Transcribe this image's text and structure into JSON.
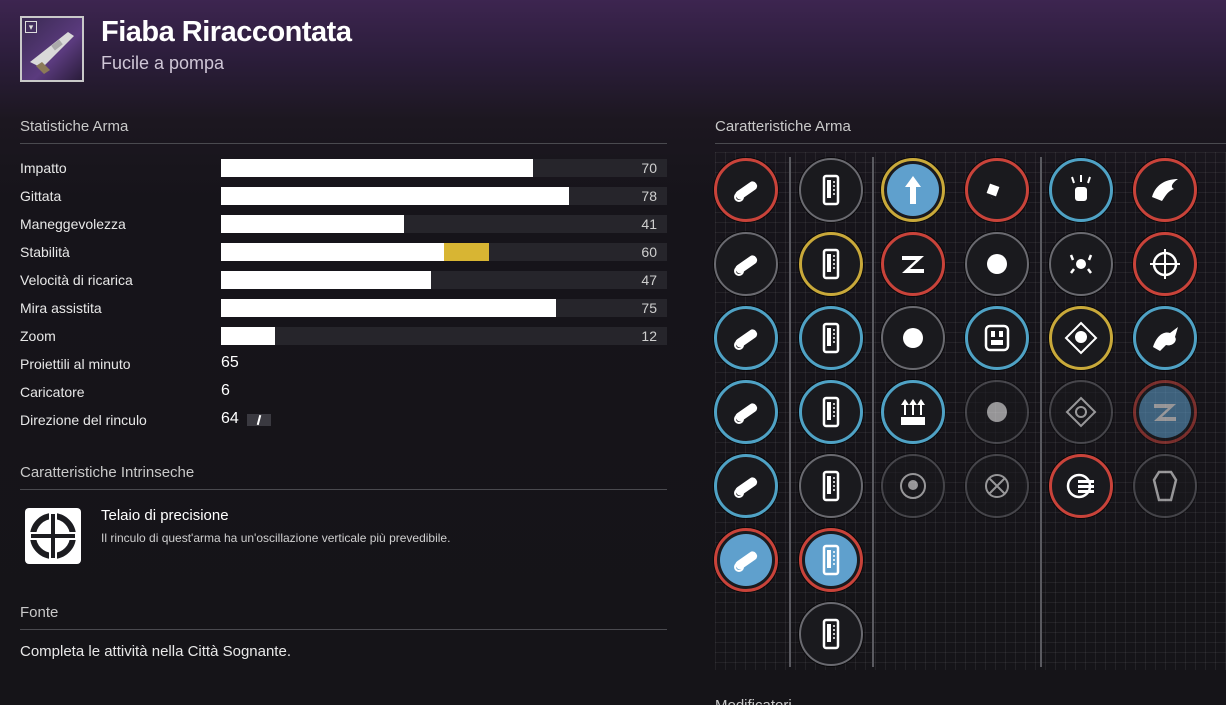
{
  "header": {
    "title": "Fiaba Riraccontata",
    "subtitle": "Fucile a pompa"
  },
  "stats_section": {
    "title": "Statistiche Arma"
  },
  "stats": [
    {
      "label": "Impatto",
      "value": "70",
      "fill": 0.7,
      "mod": 0
    },
    {
      "label": "Gittata",
      "value": "78",
      "fill": 0.78,
      "mod": 0
    },
    {
      "label": "Maneggevolezza",
      "value": "41",
      "fill": 0.41,
      "mod": 0
    },
    {
      "label": "Stabilità",
      "value": "60",
      "fill": 0.5,
      "mod": 0.1
    },
    {
      "label": "Velocità di ricarica",
      "value": "47",
      "fill": 0.47,
      "mod": 0
    },
    {
      "label": "Mira assistita",
      "value": "75",
      "fill": 0.75,
      "mod": 0
    },
    {
      "label": "Zoom",
      "value": "12",
      "fill": 0.12,
      "mod": 0
    }
  ],
  "plain_stats": [
    {
      "label": "Proiettili al minuto",
      "value": "65"
    },
    {
      "label": "Caricatore",
      "value": "6"
    },
    {
      "label": "Direzione del rinculo",
      "value": "64"
    }
  ],
  "intrinsic_section": {
    "title": "Caratteristiche Intrinseche"
  },
  "intrinsic": {
    "name": "Telaio di precisione",
    "description": "Il rinculo di quest'arma ha un'oscillazione verticale più prevedibile."
  },
  "source_section": {
    "title": "Fonte"
  },
  "source": {
    "text": "Completa le attività nella Città Sognante."
  },
  "perks_section": {
    "title": "Caratteristiche Arma"
  },
  "bottom_partial": {
    "text": "Modificatori"
  },
  "colors": {
    "stat_fill": "#ffffff",
    "stat_mod": "#d8b533",
    "ring_red": "#c9433a",
    "ring_blue": "#4fa2c5",
    "ring_gold": "#c9a93a",
    "perk_selected_bg": "#5fa0cd"
  },
  "perk_columns": [
    {
      "perks": [
        {
          "icon": "barrel-icon",
          "ring": "red",
          "selected": false
        },
        {
          "icon": "barrel-arrows-icon",
          "ring": "gray",
          "selected": false
        },
        {
          "icon": "barrel-spiral-icon",
          "ring": "blue",
          "selected": false
        },
        {
          "icon": "barrel-cone-icon",
          "ring": "blue",
          "selected": false
        },
        {
          "icon": "barrel-round-icon",
          "ring": "blue",
          "selected": false
        },
        {
          "icon": "barrel-crossed-icon",
          "ring": "red",
          "selected": true
        }
      ]
    },
    {
      "perks": [
        {
          "icon": "magazine-icon",
          "ring": "gray",
          "selected": false
        },
        {
          "icon": "magazine-striped-icon",
          "ring": "gold",
          "selected": false
        },
        {
          "icon": "magazine-ribbed-icon",
          "ring": "blue",
          "selected": false
        },
        {
          "icon": "magazine-stack-icon",
          "ring": "blue",
          "selected": false
        },
        {
          "icon": "magazine-tall-icon",
          "ring": "gray",
          "selected": false
        },
        {
          "icon": "magazine-crossed-icon",
          "ring": "red",
          "selected": true
        },
        {
          "icon": "magazine-block-icon",
          "ring": "gray",
          "selected": false
        }
      ]
    },
    {
      "perks": [
        {
          "icon": "arrow-up-icon",
          "ring": "gold",
          "selected": true
        },
        {
          "icon": "lightning-z-icon",
          "ring": "red",
          "selected": false
        },
        {
          "icon": "spiral-fist-icon",
          "ring": "gray",
          "selected": false
        },
        {
          "icon": "triple-arrow-icon",
          "ring": "blue",
          "selected": false
        },
        {
          "icon": "target-skull-icon",
          "ring": "gray",
          "selected": false,
          "dim": true
        }
      ]
    },
    {
      "perks": [
        {
          "icon": "crescent-icon",
          "ring": "red",
          "selected": false
        },
        {
          "icon": "ammo-burst-icon",
          "ring": "gray",
          "selected": false
        },
        {
          "icon": "ammo-box-icon",
          "ring": "blue",
          "selected": false
        },
        {
          "icon": "reload-arrow-icon",
          "ring": "gray",
          "selected": false,
          "dim": true
        },
        {
          "icon": "crosshair-x-icon",
          "ring": "gray",
          "selected": false,
          "dim": true
        }
      ]
    },
    {
      "perks": [
        {
          "icon": "fist-sparks-icon",
          "ring": "blue",
          "selected": false
        },
        {
          "icon": "drops-icon",
          "ring": "gray",
          "selected": false
        },
        {
          "icon": "skull-diamond-icon",
          "ring": "gold",
          "selected": false
        },
        {
          "icon": "diamond-target-icon",
          "ring": "gray",
          "selected": false,
          "dim": true
        },
        {
          "icon": "coin-stack-icon",
          "ring": "red",
          "selected": false
        }
      ]
    },
    {
      "perks": [
        {
          "icon": "wings-icon",
          "ring": "red",
          "selected": false
        },
        {
          "icon": "crosshair-spin-icon",
          "ring": "red",
          "selected": false
        },
        {
          "icon": "dragon-icon",
          "ring": "blue",
          "selected": false
        },
        {
          "icon": "lightning-z-icon",
          "ring": "red",
          "selected": true,
          "dim": true
        },
        {
          "icon": "coffin-icon",
          "ring": "gray",
          "selected": false,
          "dim": true
        }
      ]
    }
  ]
}
